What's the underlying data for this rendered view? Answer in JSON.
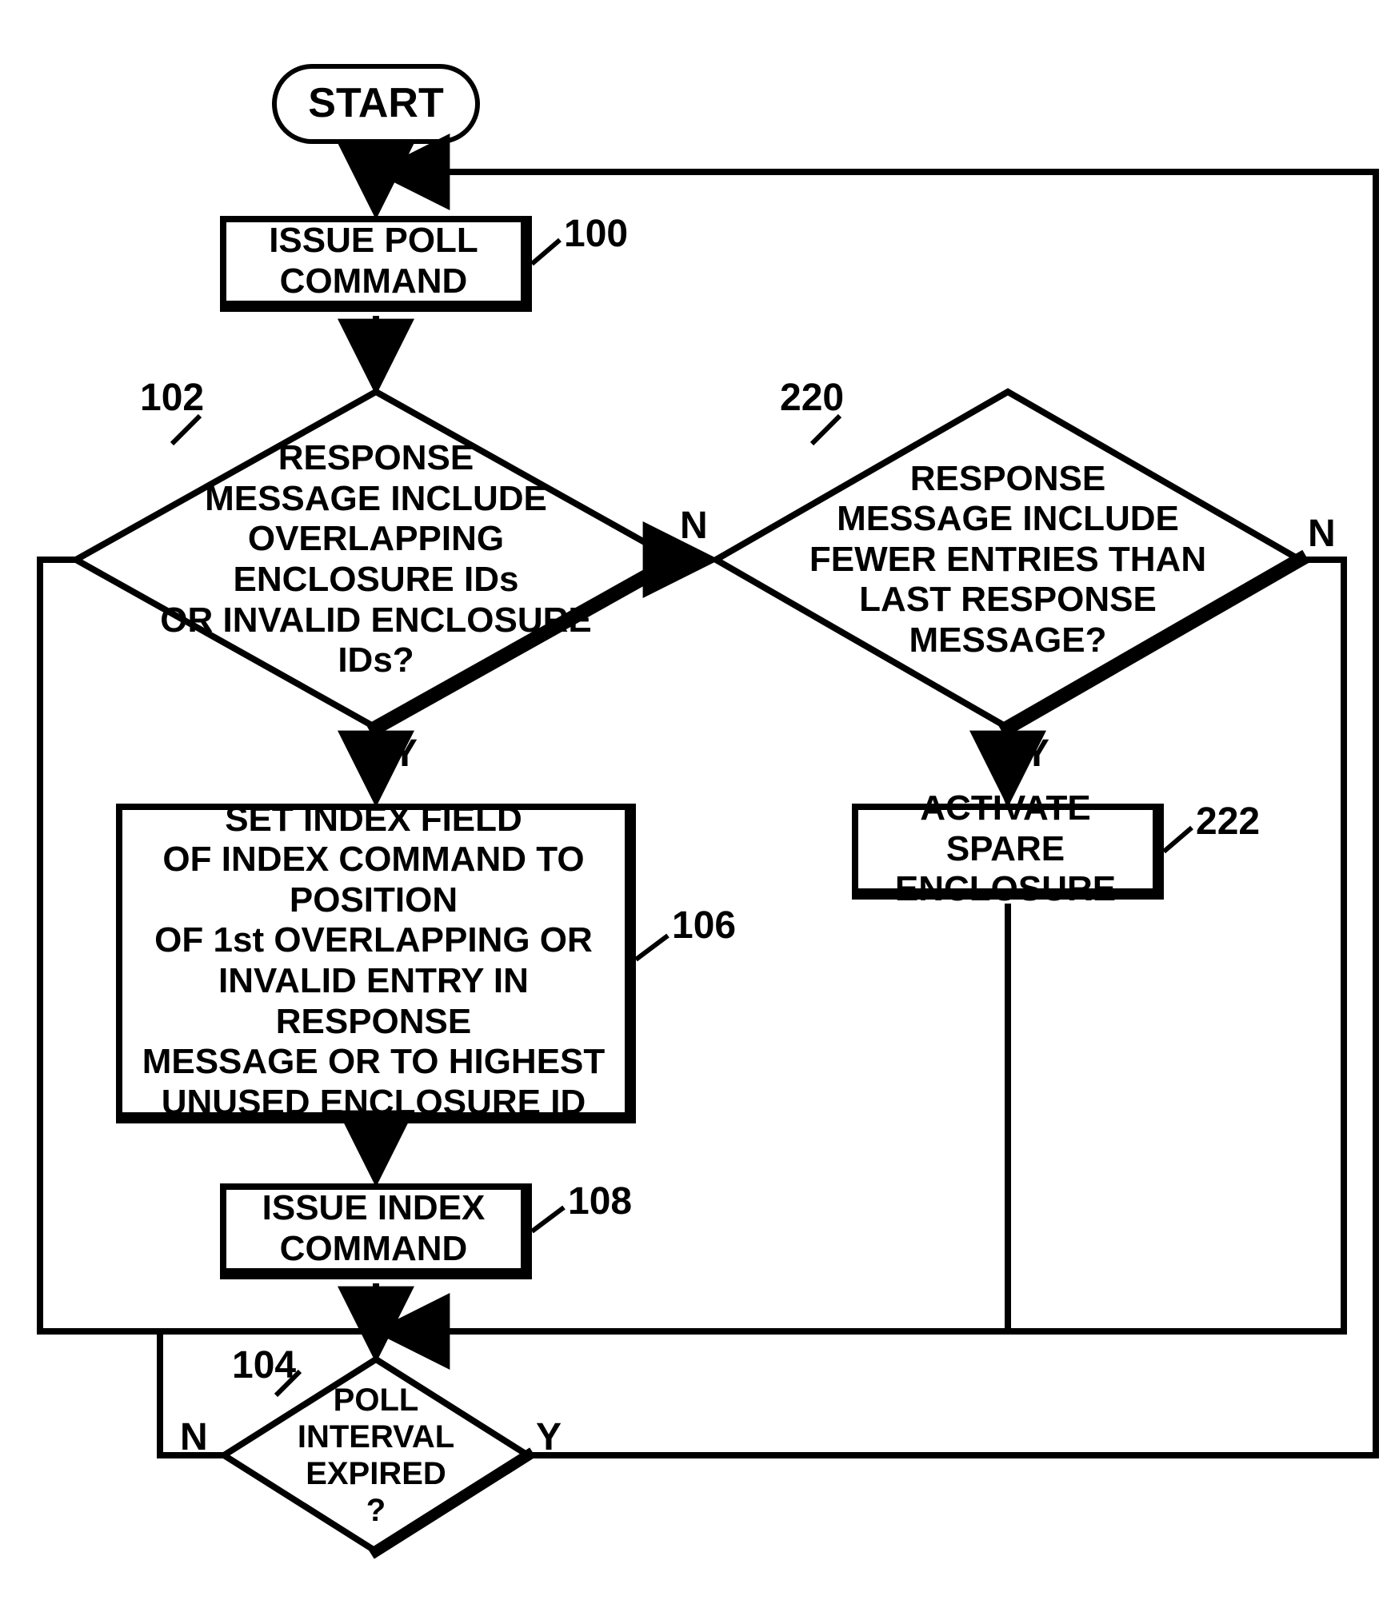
{
  "nodes": {
    "start": "START",
    "issue_poll": "ISSUE POLL\nCOMMAND",
    "decision_overlap": "RESPONSE\nMESSAGE INCLUDE\nOVERLAPPING ENCLOSURE IDs\nOR INVALID ENCLOSURE\nIDs?",
    "decision_fewer": "RESPONSE\nMESSAGE INCLUDE\nFEWER ENTRIES THAN\nLAST RESPONSE\nMESSAGE?",
    "set_index": "SET INDEX FIELD\nOF INDEX COMMAND TO POSITION\nOF 1st OVERLAPPING OR\nINVALID ENTRY IN RESPONSE\nMESSAGE OR TO HIGHEST\nUNUSED ENCLOSURE ID",
    "issue_index": "ISSUE INDEX\nCOMMAND",
    "activate_spare": "ACTIVATE SPARE\nENCLOSURE",
    "poll_interval": "POLL\nINTERVAL\nEXPIRED\n?"
  },
  "refs": {
    "issue_poll": "100",
    "decision_overlap": "102",
    "decision_fewer": "220",
    "set_index": "106",
    "issue_index": "108",
    "activate_spare": "222",
    "poll_interval": "104"
  },
  "edgeLabels": {
    "overlap_yes": "Y",
    "overlap_no": "N",
    "fewer_yes": "Y",
    "fewer_no": "N",
    "poll_yes": "Y",
    "poll_no": "N"
  }
}
